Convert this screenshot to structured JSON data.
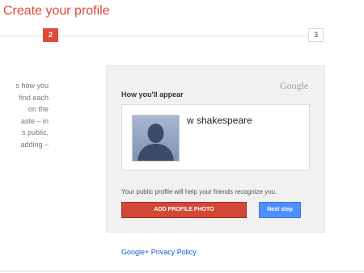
{
  "page": {
    "title": "Create your profile"
  },
  "progress": {
    "current_step": "2",
    "next_step": "3"
  },
  "side_text": {
    "lines": [
      "s how you",
      "find each",
      "on the",
      "aste – in",
      "s public,",
      "adding –"
    ]
  },
  "card": {
    "brand": "Google",
    "heading": "How you'll appear",
    "profile_name": "w shakespeare",
    "helper_text": "Your public profile will help your friends recognize you.",
    "add_photo_label": "ADD PROFILE PHOTO",
    "next_label": "Next step"
  },
  "footer": {
    "privacy_link": "Google+ Privacy Policy"
  },
  "colors": {
    "accent_red": "#dd4b39",
    "button_blue": "#4d90fe",
    "link_blue": "#1155cc"
  },
  "icons": {
    "avatar": "default-silhouette-avatar-icon"
  }
}
